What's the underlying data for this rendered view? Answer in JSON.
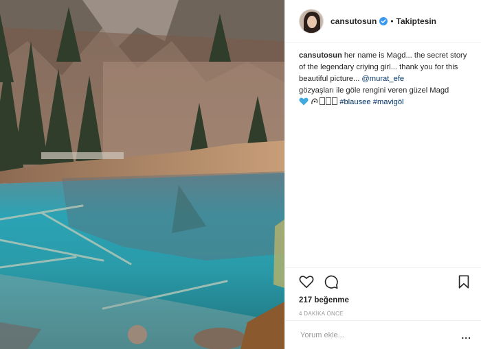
{
  "post": {
    "username": "cansutosun",
    "separator": "•",
    "follow_status": "Takiptesin",
    "caption": {
      "text": "her name is Magd... the secret story of the legendary criying girl... thank you for this beautiful picture...",
      "mention": "@murat_efe",
      "line2": "gözyaşları ile göle rengini veren güzel Magd",
      "hashtag1": "#blausee",
      "hashtag2": "#mavigöl"
    },
    "likes": "217 beğenme",
    "timestamp": "4 DAKİKA ÖNCE",
    "comment_placeholder": "Yorum ekle...",
    "more_label": "..."
  },
  "colors": {
    "lake": "#1f8f9e",
    "link": "#003569",
    "heart_emoji": "#3fa9e0"
  },
  "icons": [
    "verified-badge-icon",
    "heart-icon",
    "comment-icon",
    "bookmark-icon",
    "more-options-icon"
  ]
}
